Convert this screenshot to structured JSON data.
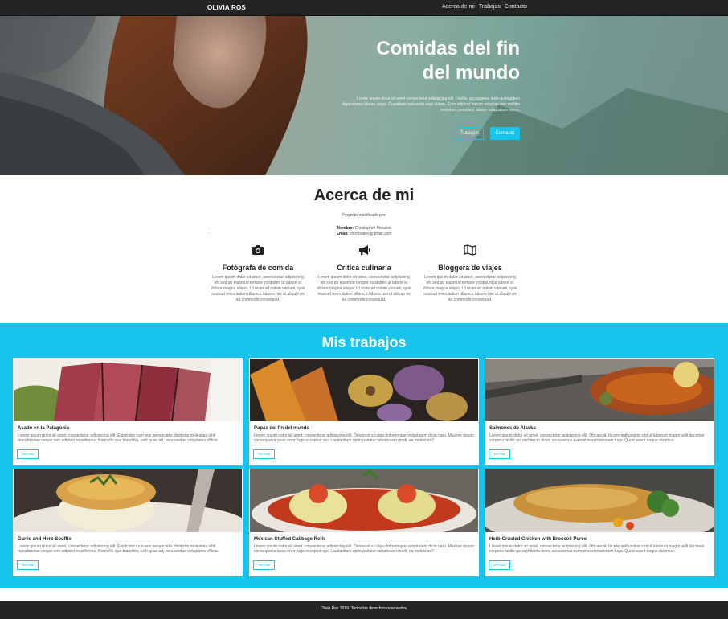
{
  "navbar": {
    "brand": "OLIVIA ROS",
    "links": [
      "Acerca de mi",
      "Trabajos",
      "Contacto"
    ]
  },
  "hero": {
    "title": "Comidas del fin del mundo",
    "description": "Lorem ipsum dolor sit amet consectetur adipisicing elit. Facilis, accusamus iusto quibusdam dignissimos labore sequi. Cupiditate reiciendis eius dolore. Eum adipisci harum voluptas iste mollitia inventore provident labore voluptatum nemo.",
    "button_works": "Trabajos",
    "button_contact": "Contacto"
  },
  "about": {
    "title": "Acerca de mi",
    "note": "Proyecto modificado por:",
    "name_label": "Nombre:",
    "name_value": "Christopher Morales",
    "email_label": "Email:",
    "email_value": "ch.morales@gmail.com",
    "features": [
      {
        "icon": "camera-icon",
        "title": "Fotógrafa de comida",
        "text": "Lorem ipsum dolor sit amet, consectetur adipisicing elit sed do eiusmod tempor incididunt ut labore et dolore magna aliqua. Ut enim ad minim veniam, quis nostrud exercitation ullamco laboris nisi ut aliquip ex ea commodo consequat."
      },
      {
        "icon": "megaphone-icon",
        "title": "Crítica culinaria",
        "text": "Lorem ipsum dolor sit amet, consectetur adipisicing elit sed do eiusmod tempor incididunt ut labore et dolore magna aliqua. Ut enim ad minim veniam, quis nostrud exercitation ullamco laboris nisi ut aliquip ex ea commodo consequat."
      },
      {
        "icon": "map-icon",
        "title": "Bloggera de viajes",
        "text": "Lorem ipsum dolor sit amet, consectetur adipisicing elit sed do eiusmod tempor incididunt ut labore et dolore magna aliqua. Ut enim ad minim veniam, quis nostrud exercitation ullamco laboris nisi ut aliquip ex ea commodo consequat."
      }
    ]
  },
  "works": {
    "title": "Mis trabajos",
    "button_label": "Ver más",
    "cards": [
      {
        "title": "Asado en la Patagonia",
        "text": "Lorem ipsum dolor sit amet, consectetur adipisicing elit. Explicabo cum eos perspiciatis distinctio molestias nihil repudiandae neque rem adipisci repellendus libero illo quo blanditiis, velit quas ad, recusandae voluptates officia."
      },
      {
        "title": "Papas del fin del mundo",
        "text": "Lorem ipsum dolor sit amet, consectetur adipisicing elit. Deserunt a culpa doloremque voluptatem dicta nam. Maxime ipsum consequatur quos error fuga excepturi qui. Laudantium optio pariatur laboriosam modi, ea molestias?"
      },
      {
        "title": "Salmones de Alaska",
        "text": "Lorem ipsum dolor sit amet, consectetur adipisicing elit. Obcaecati facere quibusdam sint ut laborum magni velit ducimus corporis facilis qui architecto dolor, accusamus eveniet exercitationem fuga. Quod averit neque ducimus."
      },
      {
        "title": "Garlic and Herb Souffle",
        "text": "Lorem ipsum dolor sit amet, consectetur adipisicing elit. Explicabo cum eos perspiciatis distinctio molestias nihil repudiandae neque rem adipisci repellendus libero illo quo blanditiis, velit quas ad, recusandae voluptates officia."
      },
      {
        "title": "Mexican Stuffed Cabbage Rolls",
        "text": "Lorem ipsum dolor sit amet, consectetur adipisicing elit. Deserunt a culpa doloremque voluptatem dicta nam. Maxime ipsum consequatur quos error fuga excepturi qui. Laudantium optio pariatur laboriosam modi, ea molestias?"
      },
      {
        "title": "Herb-Crusted Chicken with Broccoli Puree",
        "text": "Lorem ipsum dolor sit amet, consectetur adipisicing elit. Obcaecati facere quibusdam sint ut laborum magni velit ducimus corporis facilis qui architecto dolor, accusamus eveniet exercitationem fuga. Quod averit neque ducimus."
      }
    ]
  },
  "footer": {
    "text": "Olivia Ros 2019. Todos los derechos reservados."
  },
  "colors": {
    "accent": "#18c3ec",
    "dark": "#222426"
  }
}
